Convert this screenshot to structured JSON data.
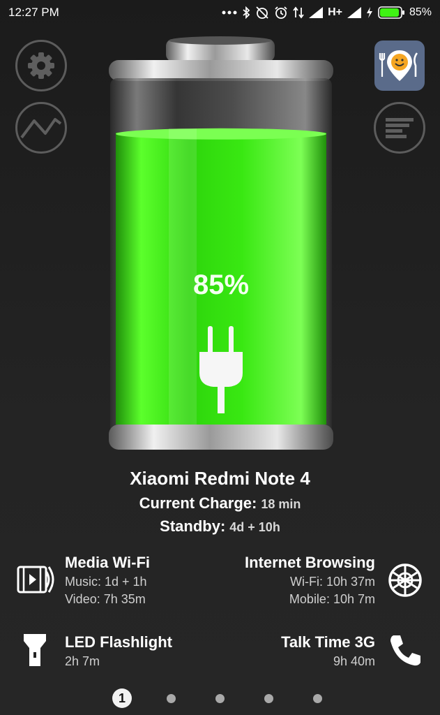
{
  "status_bar": {
    "time": "12:27 PM",
    "network": "H+",
    "battery_percent": "85%",
    "icons": [
      "more-icon",
      "bluetooth-icon",
      "alarm-off-icon",
      "alarm-icon",
      "data-arrows-icon",
      "signal-icon",
      "signal-icon",
      "charging-icon",
      "battery-icon"
    ]
  },
  "battery": {
    "level": 0.85,
    "percent_label": "85%",
    "fill_color": "#3ff214",
    "charging": true
  },
  "device": {
    "name": "Xiaomi Redmi Note 4",
    "current_charge_label": "Current Charge:",
    "current_charge_value": "18 min",
    "standby_label": "Standby:",
    "standby_value": "4d + 10h"
  },
  "stats": {
    "media": {
      "title": "Media Wi-Fi",
      "line1": "Music: 1d + 1h",
      "line2": "Video: 7h 35m",
      "icon": "video-icon"
    },
    "internet": {
      "title": "Internet Browsing",
      "line1": "Wi-Fi: 10h 37m",
      "line2": "Mobile: 10h 7m",
      "icon": "globe-icon"
    },
    "flashlight": {
      "title": "LED Flashlight",
      "line1": "2h 7m",
      "icon": "flashlight-icon"
    },
    "talk": {
      "title": "Talk Time 3G",
      "line1": "9h 40m",
      "icon": "phone-icon"
    }
  },
  "pager": {
    "current": "1",
    "total": 5
  }
}
